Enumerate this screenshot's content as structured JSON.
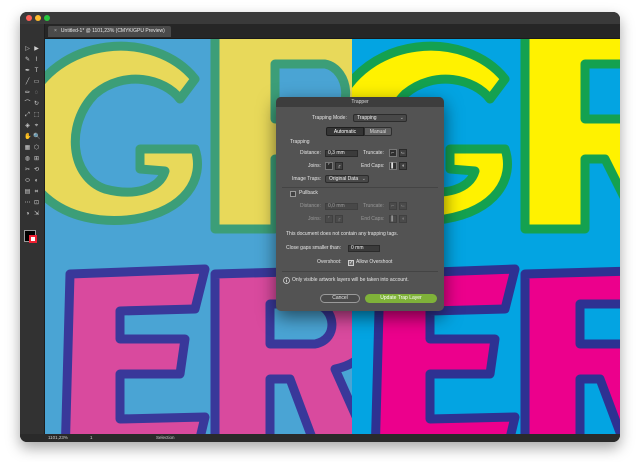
{
  "document": {
    "tab_title": "Untitled-1* @ 1101,23% (CMYK/GPU Preview)",
    "tab_close": "×"
  },
  "status": {
    "zoom": "1101,23%",
    "artboard": "1",
    "tool": "Selection"
  },
  "artwork": {
    "letters_top": "GR",
    "letters_bottom": "ERI",
    "colors": {
      "left_bg": "#4aa4d4",
      "right_bg": "#03a4e2",
      "left_top_fill": "#e8d95a",
      "right_top_fill": "#fff200",
      "left_top_stroke": "#3c9e78",
      "right_top_stroke": "#14a150",
      "left_bottom_fill": "#d94a9e",
      "right_bottom_fill": "#ec008c",
      "left_bottom_stroke": "#39389a",
      "right_bottom_stroke": "#2e3192"
    }
  },
  "dialog": {
    "title": "Trapper",
    "trapping_mode_label": "Trapping Mode:",
    "trapping_mode_value": "Trapping",
    "seg_automatic": "Automatic",
    "seg_manual": "Manual",
    "section_trapping": "Trapping",
    "distance_label": "Distance:",
    "distance_value": "0,3 mm",
    "truncate_label": "Truncate:",
    "joins_label": "Joins:",
    "endcaps_label": "End Caps:",
    "image_traps_label": "Image Traps:",
    "image_traps_value": "Original Data",
    "pullback_label": "Pullback",
    "pullback_checked": false,
    "pb_distance_label": "Distance:",
    "pb_distance_value": "0,0 mm",
    "pb_truncate_label": "Truncate:",
    "pb_joins_label": "Joins:",
    "pb_endcaps_label": "End Caps:",
    "no_tags_message": "This document does not contain any trapping tags.",
    "close_gaps_label": "Close gaps smaller than:",
    "close_gaps_value": "0 mm",
    "overshoot_label": "Overshoot:",
    "allow_overshoot_label": "Allow Overshoot",
    "allow_overshoot_checked": true,
    "info_message": "Only visible artwork layers will be taken into account.",
    "cancel_label": "Cancel",
    "update_label": "Update Trap Layer"
  },
  "icons": {
    "info": "info-icon",
    "chevron": "chevron-down-icon",
    "checkmark": "checkmark-icon",
    "miter_join": "miter-join-icon",
    "round_join": "round-join-icon",
    "butt_cap": "butt-cap-icon",
    "round_cap": "round-cap-icon"
  }
}
